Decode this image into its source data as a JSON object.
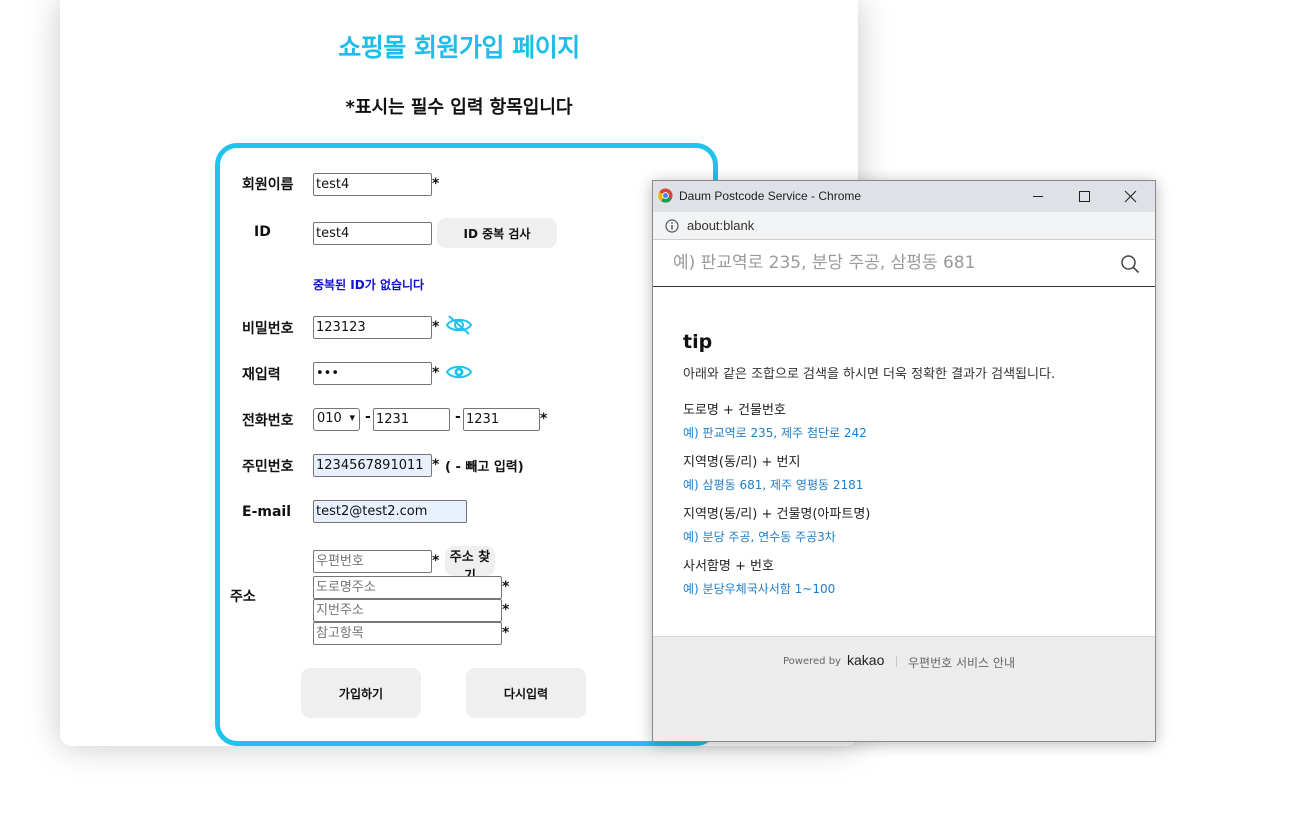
{
  "page": {
    "title": "쇼핑몰 회원가입 페이지",
    "notice": "*표시는 필수 입력 항목입니다"
  },
  "form": {
    "name": {
      "label": "회원이름",
      "value": "test4",
      "required": "*"
    },
    "id": {
      "label": "ID",
      "value": "test4",
      "check_button": "ID 중복 검사",
      "message": "중복된 ID가 없습니다",
      "message_color": "#1010d0"
    },
    "password": {
      "label": "비밀번호",
      "value": "123123",
      "required": "*",
      "icon": "eye-slash-icon"
    },
    "password_confirm": {
      "label": "재입력",
      "value": "•••",
      "required": "*",
      "icon": "eye-icon"
    },
    "phone": {
      "label": "전화번호",
      "prefix": "010",
      "dash1": "-",
      "middle": "1231",
      "dash2": "-",
      "last": "1231",
      "required": "*"
    },
    "resident": {
      "label": "주민번호",
      "value": "1234567891011",
      "required": "*",
      "hint": "( - 빼고 입력)"
    },
    "email": {
      "label": "E-mail",
      "value": "test2@test2.com"
    },
    "address": {
      "label": "주소",
      "postcode_placeholder": "우편번호",
      "postcode_required": "*",
      "find_button": "주소 찾기",
      "road_placeholder": "도로명주소",
      "road_required": "*",
      "jibun_placeholder": "지번주소",
      "jibun_required": "*",
      "extra_placeholder": "참고항목",
      "extra_required": "*"
    },
    "submit_button": "가입하기",
    "reset_button": "다시입력"
  },
  "popup": {
    "window_title": "Daum Postcode Service - Chrome",
    "url": "about:blank",
    "search_placeholder": "예) 판교역로 235, 분당 주공, 삼평동 681",
    "tip_title": "tip",
    "tip_desc": "아래와 같은 조합으로 검색을 하시면 더욱 정확한 결과가 검색됩니다.",
    "tips": [
      {
        "heading": "도로명 + 건물번호",
        "example": "예) 판교역로 235,  제주 첨단로 242"
      },
      {
        "heading": "지역명(동/리) + 번지",
        "example": "예) 삼평동 681,  제주 영평동 2181"
      },
      {
        "heading": "지역명(동/리) + 건물명(아파트명)",
        "example": "예) 분당 주공,  연수동 주공3차"
      },
      {
        "heading": "사서함명 + 번호",
        "example": "예) 분당우체국사서함 1~100"
      }
    ],
    "footer": {
      "powered_by": "Powered by",
      "brand": "kakao",
      "guide_link": "우편번호 서비스 안내"
    }
  },
  "colors": {
    "accent": "#1fc3ec",
    "title": "#1fbde9",
    "link_blue": "#1e7ec8"
  }
}
